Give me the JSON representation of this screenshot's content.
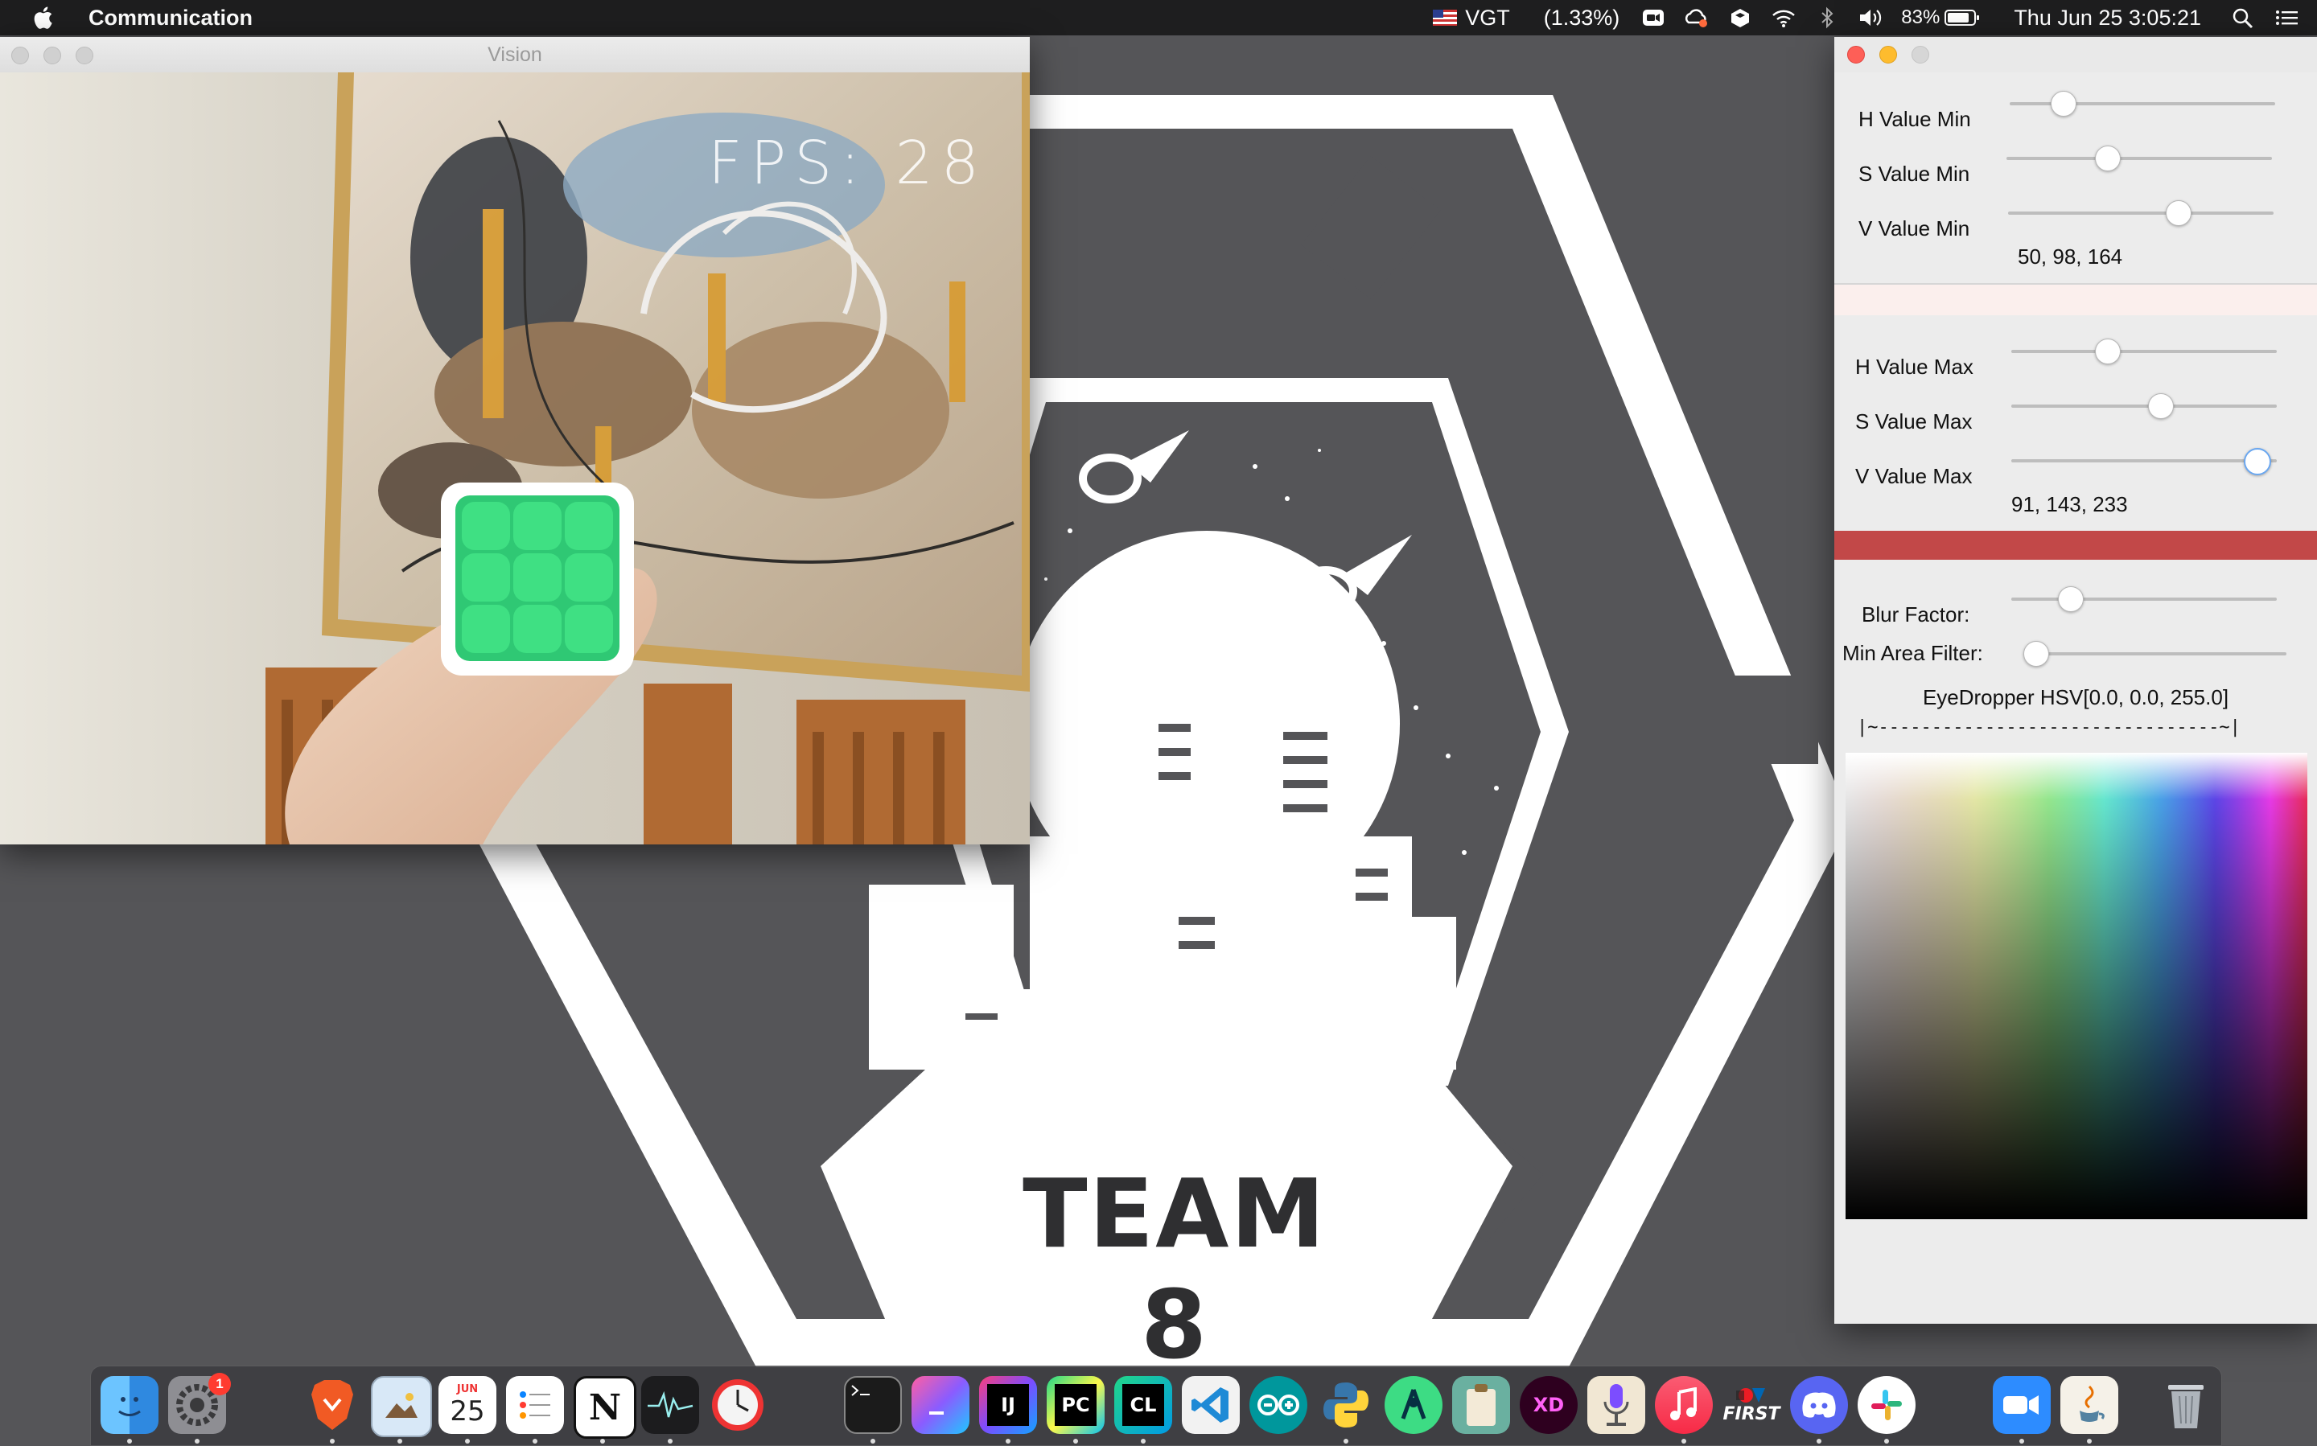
{
  "menubar": {
    "app_name": "Communication",
    "input_source": "VGT",
    "stock_change": "(1.33%)",
    "battery": "83%",
    "datetime": "Thu Jun 25  3:05:21"
  },
  "desktop": {
    "team_label": "TEAM 8"
  },
  "vision_window": {
    "title": "Vision",
    "fps_overlay": "FPS: 28"
  },
  "control_window": {
    "h_min_label": "H Value Min",
    "s_min_label": "S Value Min",
    "v_min_label": "V Value Min",
    "min_values": "50, 98, 164",
    "h_max_label": "H Value Max",
    "s_max_label": "S Value Max",
    "v_max_label": "V Value Max",
    "max_values": "91, 143, 233",
    "blur_label": "Blur Factor:",
    "min_area_label": "Min Area Filter:",
    "eyedropper_label": "EyeDropper HSV[0.0, 0.0, 255.0]",
    "ruler_text": "|~--------------------------------~|",
    "min_swatch_color": "#fbefed",
    "max_swatch_color": "#c24848",
    "slider_levels": {
      "h_min": 0.2,
      "s_min": 0.38,
      "v_min": 0.64,
      "h_max": 0.36,
      "s_max": 0.56,
      "v_max": 0.92,
      "blur": 0.22,
      "min_area": 0.0
    }
  },
  "dock": {
    "badge_count": "1",
    "calendar_day": "25",
    "calendar_month": "JUN",
    "notion_letter": "N",
    "intellij_label": "IJ",
    "pycharm_label": "PC",
    "clion_label": "CL",
    "xd_label": "XD",
    "first_label": "FIRST",
    "icons": [
      "finder-icon",
      "system-preferences-icon",
      "brave-icon",
      "preview-icon",
      "calendar-icon",
      "reminders-icon",
      "notion-icon",
      "activity-monitor-icon",
      "time-machine-icon",
      "terminal-icon",
      "visual-studio-icon",
      "intellij-icon",
      "pycharm-icon",
      "clion-icon",
      "vscode-icon",
      "arduino-icon",
      "python-icon",
      "android-studio-icon",
      "clipboard-icon",
      "adobe-xd-icon",
      "podcast-icon",
      "music-icon",
      "first-icon",
      "discord-icon",
      "slack-icon",
      "zoom-icon",
      "java-icon",
      "trash-icon"
    ]
  }
}
